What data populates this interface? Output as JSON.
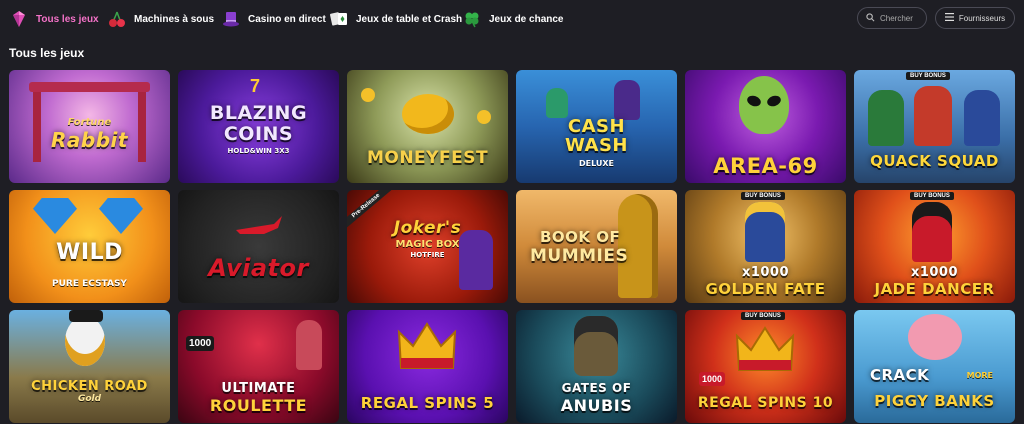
{
  "nav": {
    "items": [
      {
        "label": "Tous les jeux",
        "icon": "diamond-icon",
        "active": true
      },
      {
        "label": "Machines à sous",
        "icon": "cherries-icon"
      },
      {
        "label": "Casino en direct",
        "icon": "top-hat-icon"
      },
      {
        "label": "Jeux de table et Crash",
        "icon": "cards-icon"
      },
      {
        "label": "Jeux de chance",
        "icon": "clover-icon"
      }
    ]
  },
  "search": {
    "placeholder": "Chercher",
    "icon": "search-icon"
  },
  "providers": {
    "label": "Fournisseurs",
    "icon": "menu-icon"
  },
  "section": {
    "title": "Tous les jeux"
  },
  "games": [
    {
      "title": "Fortune",
      "title2": "Rabbit"
    },
    {
      "title": "BLAZING",
      "title2": "COINS",
      "sub": "HOLD&WIN 3X3"
    },
    {
      "title": "MONEYFEST"
    },
    {
      "title": "CASH",
      "title2": "WASH",
      "sub": "DELUXE"
    },
    {
      "title": "AREA-69"
    },
    {
      "title": "QUACK SQUAD",
      "badge": "BUY BONUS"
    },
    {
      "title": "WILD",
      "title2": "PURE ECSTASY"
    },
    {
      "title": "Aviator"
    },
    {
      "title": "Joker's",
      "title2": "MAGIC BOX",
      "sub": "HOTFIRE",
      "badge": "Pre-Release"
    },
    {
      "title": "BOOK OF",
      "title2": "MUMMIES"
    },
    {
      "title": "x1000",
      "title2": "GOLDEN FATE",
      "badge": "BUY BONUS"
    },
    {
      "title": "x1000",
      "title2": "JADE DANCER",
      "badge": "BUY BONUS"
    },
    {
      "title": "CHICKEN ROAD",
      "title2": "Gold"
    },
    {
      "title": "ULTIMATE",
      "title2": "ROULETTE",
      "sub": "1000"
    },
    {
      "title": "REGAL SPINS 5"
    },
    {
      "title": "GATES OF",
      "title2": "ANUBIS"
    },
    {
      "title": "REGAL SPINS 10",
      "sub": "1000",
      "badge": "BUY BONUS"
    },
    {
      "title": "CRACK",
      "title2": "PIGGY BANKS",
      "sub": "MORE"
    }
  ]
}
